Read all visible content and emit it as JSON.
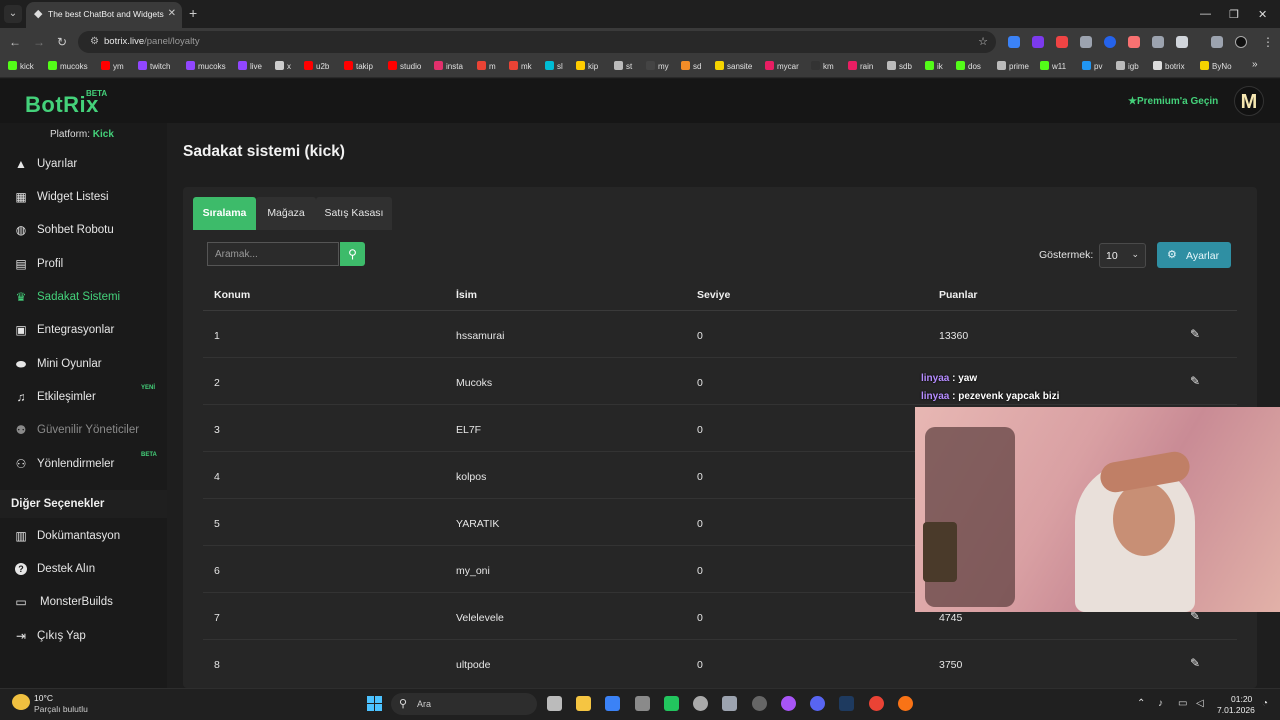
{
  "browser": {
    "tab_title": "The best ChatBot and Widgets",
    "url_domain": "botrix.live",
    "url_path": "/panel/loyalty",
    "bookmarks": [
      {
        "label": "kick",
        "color": "#53fc18"
      },
      {
        "label": "mucoks",
        "color": "#53fc18"
      },
      {
        "label": "ym",
        "color": "#ff0000"
      },
      {
        "label": "twitch",
        "color": "#9146ff"
      },
      {
        "label": "mucoks",
        "color": "#9146ff"
      },
      {
        "label": "live",
        "color": "#9146ff"
      },
      {
        "label": "x",
        "color": "#cccccc"
      },
      {
        "label": "u2b",
        "color": "#ff0000"
      },
      {
        "label": "takip",
        "color": "#ff0000"
      },
      {
        "label": "studio",
        "color": "#ff0000"
      },
      {
        "label": "insta",
        "color": "#e1306c"
      },
      {
        "label": "m",
        "color": "#ea4335"
      },
      {
        "label": "mk",
        "color": "#ea4335"
      },
      {
        "label": "sl",
        "color": "#00bcd4"
      },
      {
        "label": "kip",
        "color": "#ffcc00"
      },
      {
        "label": "st",
        "color": "#bbbbbb"
      },
      {
        "label": "my",
        "color": "#444444"
      },
      {
        "label": "sd",
        "color": "#f28c28"
      },
      {
        "label": "sansite",
        "color": "#f5d400"
      },
      {
        "label": "mycar",
        "color": "#e91e63"
      },
      {
        "label": "km",
        "color": "#333333"
      },
      {
        "label": "rain",
        "color": "#e91e63"
      },
      {
        "label": "sdb",
        "color": "#bbbbbb"
      },
      {
        "label": "ik",
        "color": "#53fc18"
      },
      {
        "label": "dos",
        "color": "#53fc18"
      },
      {
        "label": "prime",
        "color": "#bbbbbb"
      },
      {
        "label": "w11",
        "color": "#53fc18"
      },
      {
        "label": "pv",
        "color": "#2196f3"
      },
      {
        "label": "igb",
        "color": "#bbbbbb"
      },
      {
        "label": "botrix",
        "color": "#dddddd"
      },
      {
        "label": "ByNo",
        "color": "#f5d400"
      }
    ]
  },
  "app": {
    "logo": "BotRix",
    "logo_badge": "BETA",
    "premium_label": "Premium'a Geçin",
    "avatar_letter": "M"
  },
  "sidebar": {
    "platform_label": "Platform:",
    "platform_value": "Kick",
    "items": [
      {
        "label": "Uyarılar",
        "icon": "warning-icon",
        "glyph": "▲"
      },
      {
        "label": "Widget Listesi",
        "icon": "grid-icon",
        "glyph": "▦"
      },
      {
        "label": "Sohbet Robotu",
        "icon": "robot-icon",
        "glyph": "◍"
      },
      {
        "label": "Profil",
        "icon": "id-card-icon",
        "glyph": "▤"
      },
      {
        "label": "Sadakat Sistemi",
        "icon": "trophy-icon",
        "glyph": "♛",
        "active": true
      },
      {
        "label": "Entegrasyonlar",
        "icon": "plug-icon",
        "glyph": "▣"
      },
      {
        "label": "Mini Oyunlar",
        "icon": "gamepad-icon",
        "glyph": "⬬"
      },
      {
        "label": "Etkileşimler",
        "icon": "music-icon",
        "glyph": "♫",
        "badge": "YENİ"
      },
      {
        "label": "Güvenilir Yöneticiler",
        "icon": "users-icon",
        "glyph": "⚉",
        "disabled": true
      },
      {
        "label": "Yönlendirmeler",
        "icon": "user-group-icon",
        "glyph": "⚇",
        "badge": "BETA"
      }
    ],
    "section_title": "Diğer Seçenekler",
    "other_items": [
      {
        "label": "Dokümantasyon",
        "icon": "book-icon",
        "glyph": "▥"
      },
      {
        "label": "Destek Alın",
        "icon": "question-icon",
        "glyph": "?"
      },
      {
        "label": "MonsterBuilds",
        "icon": "laptop-icon",
        "glyph": "▭"
      },
      {
        "label": "Çıkış Yap",
        "icon": "logout-icon",
        "glyph": "⇥"
      }
    ]
  },
  "page": {
    "title": "Sadakat sistemi (kick)",
    "tabs": [
      "Sıralama",
      "Mağaza",
      "Satış Kasası"
    ],
    "search_placeholder": "Aramak...",
    "show_label": "Göstermek:",
    "show_value": "10",
    "settings_label": "Ayarlar",
    "columns": [
      "Konum",
      "İsim",
      "Seviye",
      "Puanlar"
    ],
    "rows": [
      {
        "rank": "1",
        "name": "hssamurai",
        "level": "0",
        "points": "13360"
      },
      {
        "rank": "2",
        "name": "Mucoks",
        "level": "0",
        "points": ""
      },
      {
        "rank": "3",
        "name": "EL7F",
        "level": "0",
        "points": ""
      },
      {
        "rank": "4",
        "name": "kolpos",
        "level": "0",
        "points": ""
      },
      {
        "rank": "5",
        "name": "YARATIK",
        "level": "0",
        "points": ""
      },
      {
        "rank": "6",
        "name": "my_oni",
        "level": "0",
        "points": ""
      },
      {
        "rank": "7",
        "name": "Velelevele",
        "level": "0",
        "points": "4745"
      },
      {
        "rank": "8",
        "name": "ultpode",
        "level": "0",
        "points": "3750"
      }
    ]
  },
  "overlay": {
    "chat": [
      {
        "user": "linyaa",
        "message": ": yaw"
      },
      {
        "user": "linyaa",
        "message": ": pezevenk yapcak bizi"
      }
    ]
  },
  "taskbar": {
    "temperature": "10°C",
    "weather": "Parçalı bulutlu",
    "search_label": "Ara",
    "time": "01:20",
    "date": "7.01.2026"
  }
}
